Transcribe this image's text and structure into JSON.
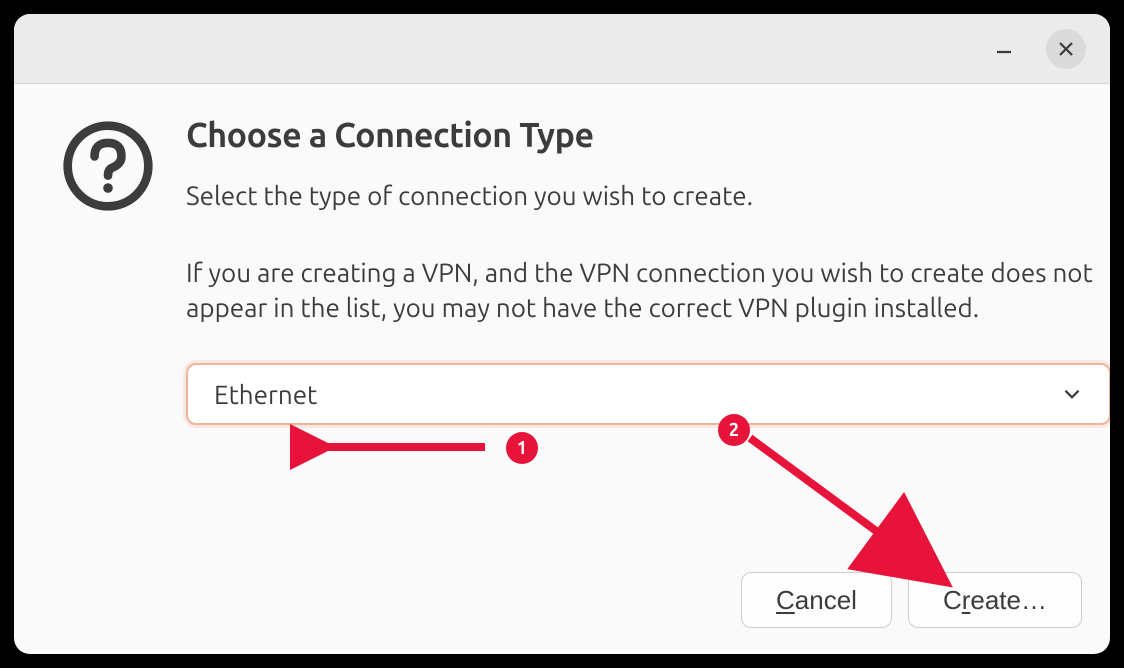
{
  "dialog": {
    "title": "Choose a Connection Type",
    "description1": "Select the type of connection you wish to create.",
    "description2": "If you are creating a VPN, and the VPN connection you wish to create does not appear in the list, you may not have the correct VPN plugin installed.",
    "dropdown_selected": "Ethernet",
    "cancel_label": "Cancel",
    "create_label": "Create…"
  },
  "annotations": {
    "badge1": "1",
    "badge2": "2"
  }
}
